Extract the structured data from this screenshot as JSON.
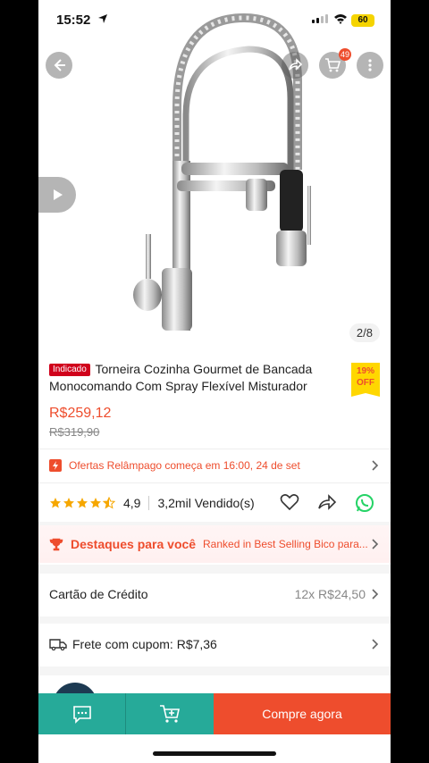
{
  "status_bar": {
    "time": "15:52",
    "battery": "60"
  },
  "gallery": {
    "page_indicator": "2/8",
    "cart_count": "49"
  },
  "product": {
    "tag": "Indicado",
    "title": "Torneira Cozinha Gourmet de Bancada Monocomando Com Spray Flexível Misturador",
    "discount_pct": "19%",
    "discount_label": "OFF",
    "price": "R$259,12",
    "old_price": "R$319,90"
  },
  "flash_sale": {
    "text": "Ofertas Relâmpago começa em 16:00, 24 de set"
  },
  "rating": {
    "value": "4,9",
    "sold": "3,2mil Vendido(s)",
    "stars": 4.5
  },
  "highlights": {
    "title": "Destaques para você",
    "subtitle": "Ranked in Best Selling Bico para..."
  },
  "payment": {
    "label": "Cartão de Crédito",
    "installments": "12x R$24,50"
  },
  "shipping": {
    "label": "Frete com cupom: R$7,36"
  },
  "bottom_bar": {
    "buy_label": "Compre agora"
  },
  "colors": {
    "accent": "#ee4d2d",
    "teal": "#26aa99",
    "yellow": "#ffd700"
  }
}
